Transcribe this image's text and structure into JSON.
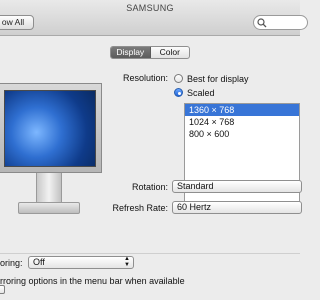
{
  "window": {
    "title": "SAMSUNG",
    "show_all_label": "ow All"
  },
  "tabs": [
    {
      "label": "Display",
      "active": true
    },
    {
      "label": "Color",
      "active": false
    }
  ],
  "resolution": {
    "label": "Resolution:",
    "options": [
      {
        "label": "Best for display",
        "selected": false
      },
      {
        "label": "Scaled",
        "selected": true
      }
    ],
    "list": [
      "1360 × 768",
      "1024 × 768",
      "800 × 600"
    ],
    "selected_index": 0
  },
  "rotation": {
    "label": "Rotation:",
    "value": "Standard"
  },
  "refresh_rate": {
    "label": "Refresh Rate:",
    "value": "60 Hertz"
  },
  "mirroring": {
    "label": "oring:",
    "value": "Off"
  },
  "mirroring_menu_bar": {
    "label": "rroring options in the menu bar when available"
  },
  "colors": {
    "accent": "#3875d7",
    "selected_text": "#ffffff"
  },
  "icons": {
    "search": "search-icon",
    "popup_arrows": "updown-arrows-icon"
  }
}
